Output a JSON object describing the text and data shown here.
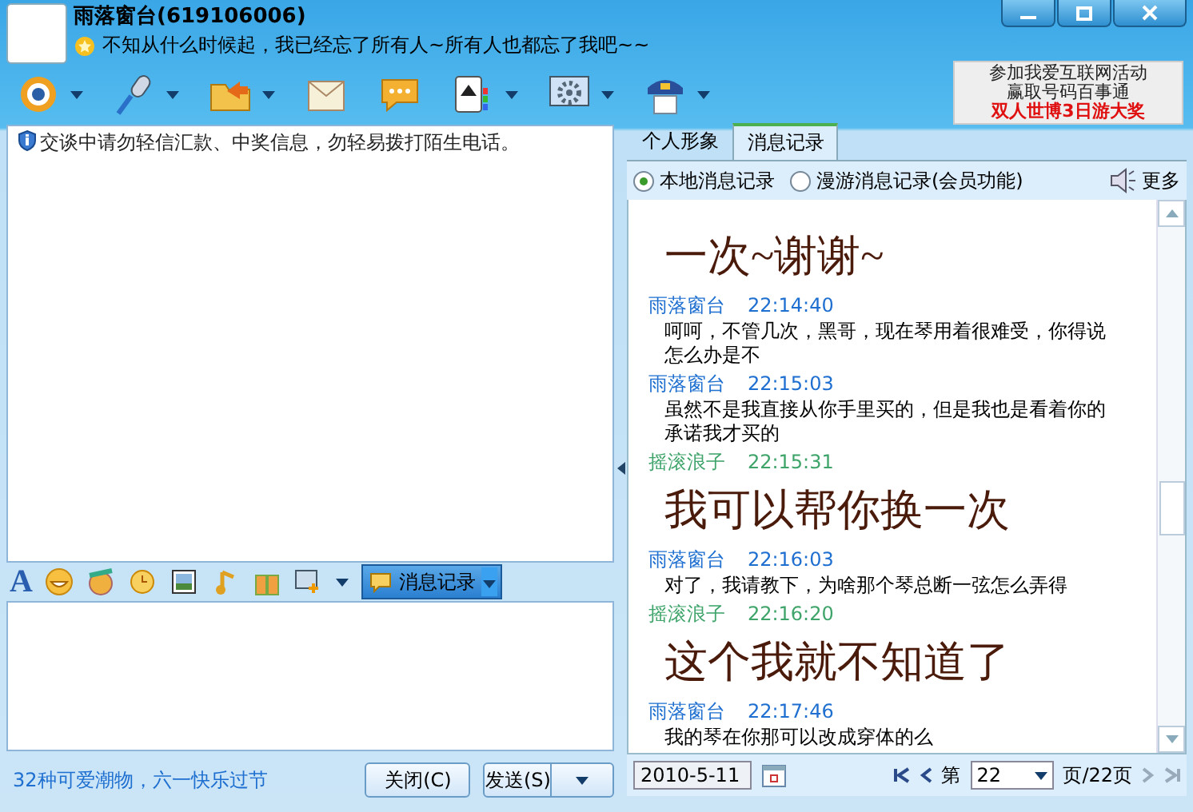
{
  "window": {
    "title": "雨落窗台(619106006)",
    "status": "不知从什么时候起，我已经忘了所有人~所有人也都忘了我吧~~"
  },
  "ad": [
    {
      "text": "参加我爱互联网活动",
      "highlight": false
    },
    {
      "text": "赢取号码百事通",
      "highlight": false
    },
    {
      "text": "双人世博3日游大奖",
      "highlight": true
    }
  ],
  "notice": "交谈中请勿轻信汇款、中奖信息，勿轻易拨打陌生电话。",
  "format_bar": {
    "font_button": "A",
    "history_button": "消息记录"
  },
  "footer": {
    "promo": "32种可爱潮物，六一快乐过节",
    "close_button": "关闭(C)",
    "send_button": "发送(S)"
  },
  "tabs": [
    {
      "label": "个人形象",
      "selected": false
    },
    {
      "label": "消息记录",
      "selected": true
    }
  ],
  "history_options": [
    {
      "label": "本地消息记录",
      "selected": true
    },
    {
      "label": "漫游消息记录(会员功能)",
      "selected": false
    }
  ],
  "more_button": "更多",
  "messages": [
    {
      "kind": "large",
      "text": "一次~谢谢~"
    },
    {
      "kind": "normal",
      "sender": "雨落窗台",
      "time": "22:14:40",
      "color": "#1e6fd0",
      "text": "呵呵，不管几次，黑哥，现在琴用着很难受，你得说怎么办是不"
    },
    {
      "kind": "normal",
      "sender": "雨落窗台",
      "time": "22:15:03",
      "color": "#1e6fd0",
      "text": "虽然不是我直接从你手里买的，但是我也是看着你的承诺我才买的"
    },
    {
      "kind": "large",
      "sender": "摇滚浪子",
      "time": "22:15:31",
      "color": "#3ea46a",
      "text": "我可以帮你换一次"
    },
    {
      "kind": "normal",
      "sender": "雨落窗台",
      "time": "22:16:03",
      "color": "#1e6fd0",
      "text": "对了，我请教下，为啥那个琴总断一弦怎么弄得"
    },
    {
      "kind": "large",
      "sender": "摇滚浪子",
      "time": "22:16:20",
      "color": "#3ea46a",
      "text": "这个我就不知道了"
    },
    {
      "kind": "normal",
      "sender": "雨落窗台",
      "time": "22:17:46",
      "color": "#1e6fd0",
      "text": "我的琴在你那可以改成穿体的么"
    }
  ],
  "pager": {
    "date": "2010-5-11",
    "page_prefix": "第",
    "page": "22",
    "page_suffix": "页/22页"
  }
}
